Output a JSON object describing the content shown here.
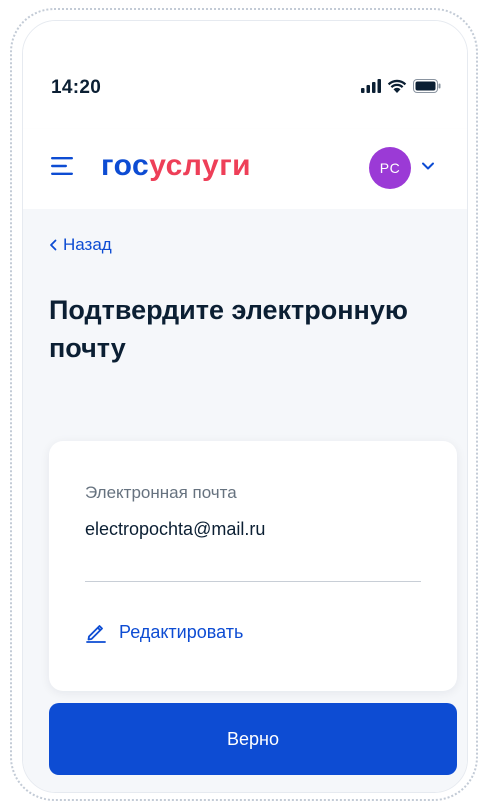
{
  "status_bar": {
    "time": "14:20",
    "signal_icon": "cellular-signal-icon",
    "wifi_icon": "wifi-icon",
    "battery_icon": "battery-icon"
  },
  "header": {
    "menu_icon": "hamburger-menu-icon",
    "logo_part1": "гос",
    "logo_part2": "услуги",
    "avatar_initials": "PC",
    "dropdown_icon": "chevron-down-icon"
  },
  "navigation": {
    "back_label": "Назад"
  },
  "page": {
    "title": "Подтвердите электронную почту"
  },
  "email_card": {
    "label": "Электронная почта",
    "value": "electropochta@mail.ru",
    "edit_label": "Редактировать",
    "edit_icon": "pencil-icon"
  },
  "actions": {
    "confirm_label": "Верно"
  },
  "colors": {
    "primary": "#0d4cd3",
    "logo_accent": "#ee3f58",
    "avatar_bg": "#9b3ad6",
    "text": "#0b1f33",
    "muted_text": "#66727f",
    "background": "#f5f7fa"
  }
}
